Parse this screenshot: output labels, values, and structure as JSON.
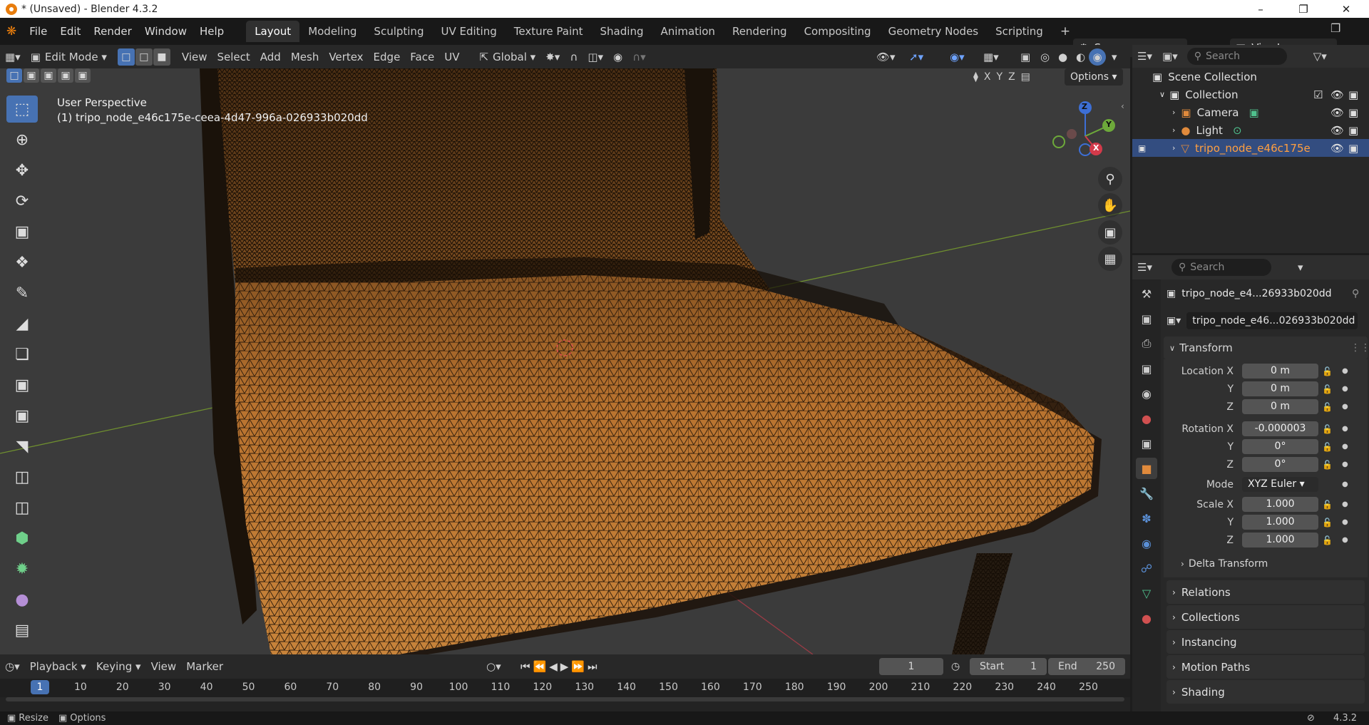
{
  "window": {
    "title": "* (Unsaved) - Blender 4.3.2"
  },
  "menu": [
    "File",
    "Edit",
    "Render",
    "Window",
    "Help"
  ],
  "workspaces": [
    "Layout",
    "Modeling",
    "Sculpting",
    "UV Editing",
    "Texture Paint",
    "Shading",
    "Animation",
    "Rendering",
    "Compositing",
    "Geometry Nodes",
    "Scripting"
  ],
  "active_workspace": "Layout",
  "scene": {
    "name": "Scene",
    "view_layer": "ViewLayer"
  },
  "header": {
    "mode": "Edit Mode",
    "menus": [
      "View",
      "Select",
      "Add",
      "Mesh",
      "Vertex",
      "Edge",
      "Face",
      "UV"
    ],
    "orientation": "Global",
    "options_label": "Options",
    "axis_x": "X",
    "axis_y": "Y",
    "axis_z": "Z"
  },
  "viewport": {
    "view_name": "User Perspective",
    "object_line": "(1) tripo_node_e46c175e-ceea-4d47-996a-026933b020dd",
    "mesh_color": "#b06d2c"
  },
  "gizmo": {
    "x": "X",
    "y": "Y",
    "z": "Z"
  },
  "outliner": {
    "search_placeholder": "Search",
    "rows": [
      "Scene Collection",
      "Collection",
      "Camera",
      "Light",
      "tripo_node_e46c175e"
    ]
  },
  "properties": {
    "search_placeholder": "Search",
    "object_name": "tripo_node_e4...26933b020dd",
    "data_name": "tripo_node_e46...026933b020dd",
    "transform_label": "Transform",
    "location_label": "Location X",
    "rotation_label": "Rotation X",
    "scale_label": "Scale X",
    "y_label": "Y",
    "z_label": "Z",
    "mode_label": "Mode",
    "location": [
      "0 m",
      "0 m",
      "0 m"
    ],
    "rotation": [
      "-0.000003",
      "0°",
      "0°"
    ],
    "rotation_mode": "XYZ Euler",
    "scale": [
      "1.000",
      "1.000",
      "1.000"
    ],
    "delta": "Delta Transform",
    "sections": [
      "Relations",
      "Collections",
      "Instancing",
      "Motion Paths",
      "Shading"
    ]
  },
  "timeline": {
    "menus": [
      "Playback",
      "Keying",
      "View",
      "Marker"
    ],
    "current_frame": "1",
    "start_label": "Start",
    "start": "1",
    "end_label": "End",
    "end": "250",
    "ruler_current": "1",
    "ticks": [
      "10",
      "20",
      "30",
      "40",
      "50",
      "60",
      "70",
      "80",
      "90",
      "100",
      "110",
      "120",
      "130",
      "140",
      "150",
      "160",
      "170",
      "180",
      "190",
      "200",
      "210",
      "220",
      "230",
      "240",
      "250"
    ]
  },
  "status": {
    "left1": "Resize",
    "left2": "Options",
    "version": "4.3.2"
  }
}
